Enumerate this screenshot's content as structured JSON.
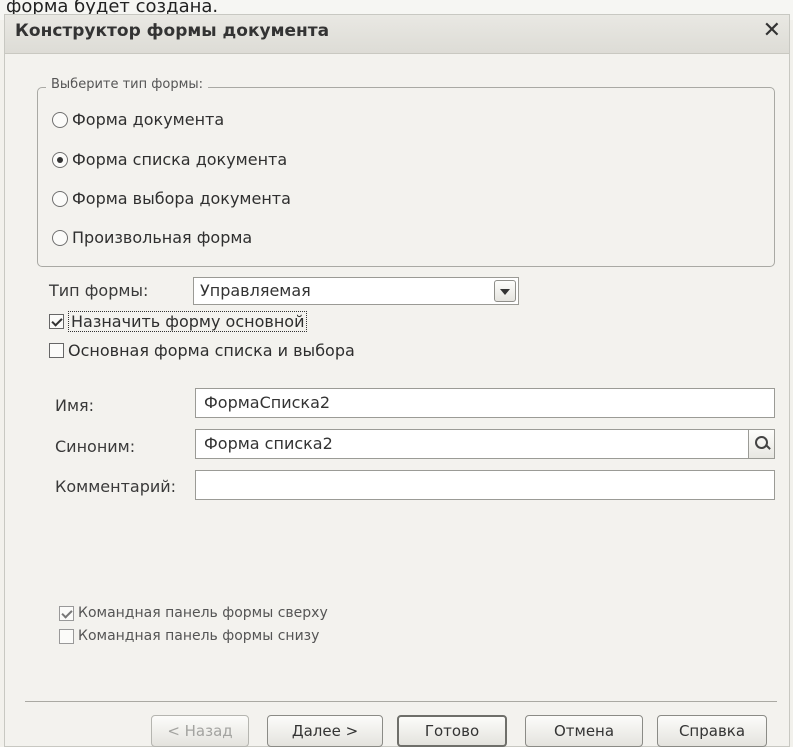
{
  "background": {
    "fragment_text": "форма будет создана."
  },
  "dialog": {
    "title": "Конструктор формы документа",
    "close_symbol": "✕",
    "form_type_group": {
      "legend": "Выберите тип формы:",
      "options": [
        {
          "label": "Форма документа",
          "selected": false
        },
        {
          "label": "Форма списка документа",
          "selected": true
        },
        {
          "label": "Форма выбора документа",
          "selected": false
        },
        {
          "label": "Произвольная форма",
          "selected": false
        }
      ]
    },
    "form_kind": {
      "label": "Тип формы:",
      "value": "Управляемая"
    },
    "checkbox_main": {
      "label": "Назначить форму основной",
      "checked": true
    },
    "checkbox_list_main": {
      "label": "Основная форма списка и выбора",
      "checked": false
    },
    "name": {
      "label": "Имя:",
      "value": "ФормаСписка2"
    },
    "synonym": {
      "label": "Синоним:",
      "value": "Форма списка2"
    },
    "comment": {
      "label": "Комментарий:",
      "value": ""
    },
    "cmd_top": {
      "label": "Командная панель формы сверху",
      "checked": true
    },
    "cmd_bottom": {
      "label": "Командная панель формы снизу",
      "checked": false
    },
    "buttons": {
      "back": "< Назад",
      "next": "Далее >",
      "done": "Готово",
      "cancel": "Отмена",
      "help": "Справка"
    }
  }
}
